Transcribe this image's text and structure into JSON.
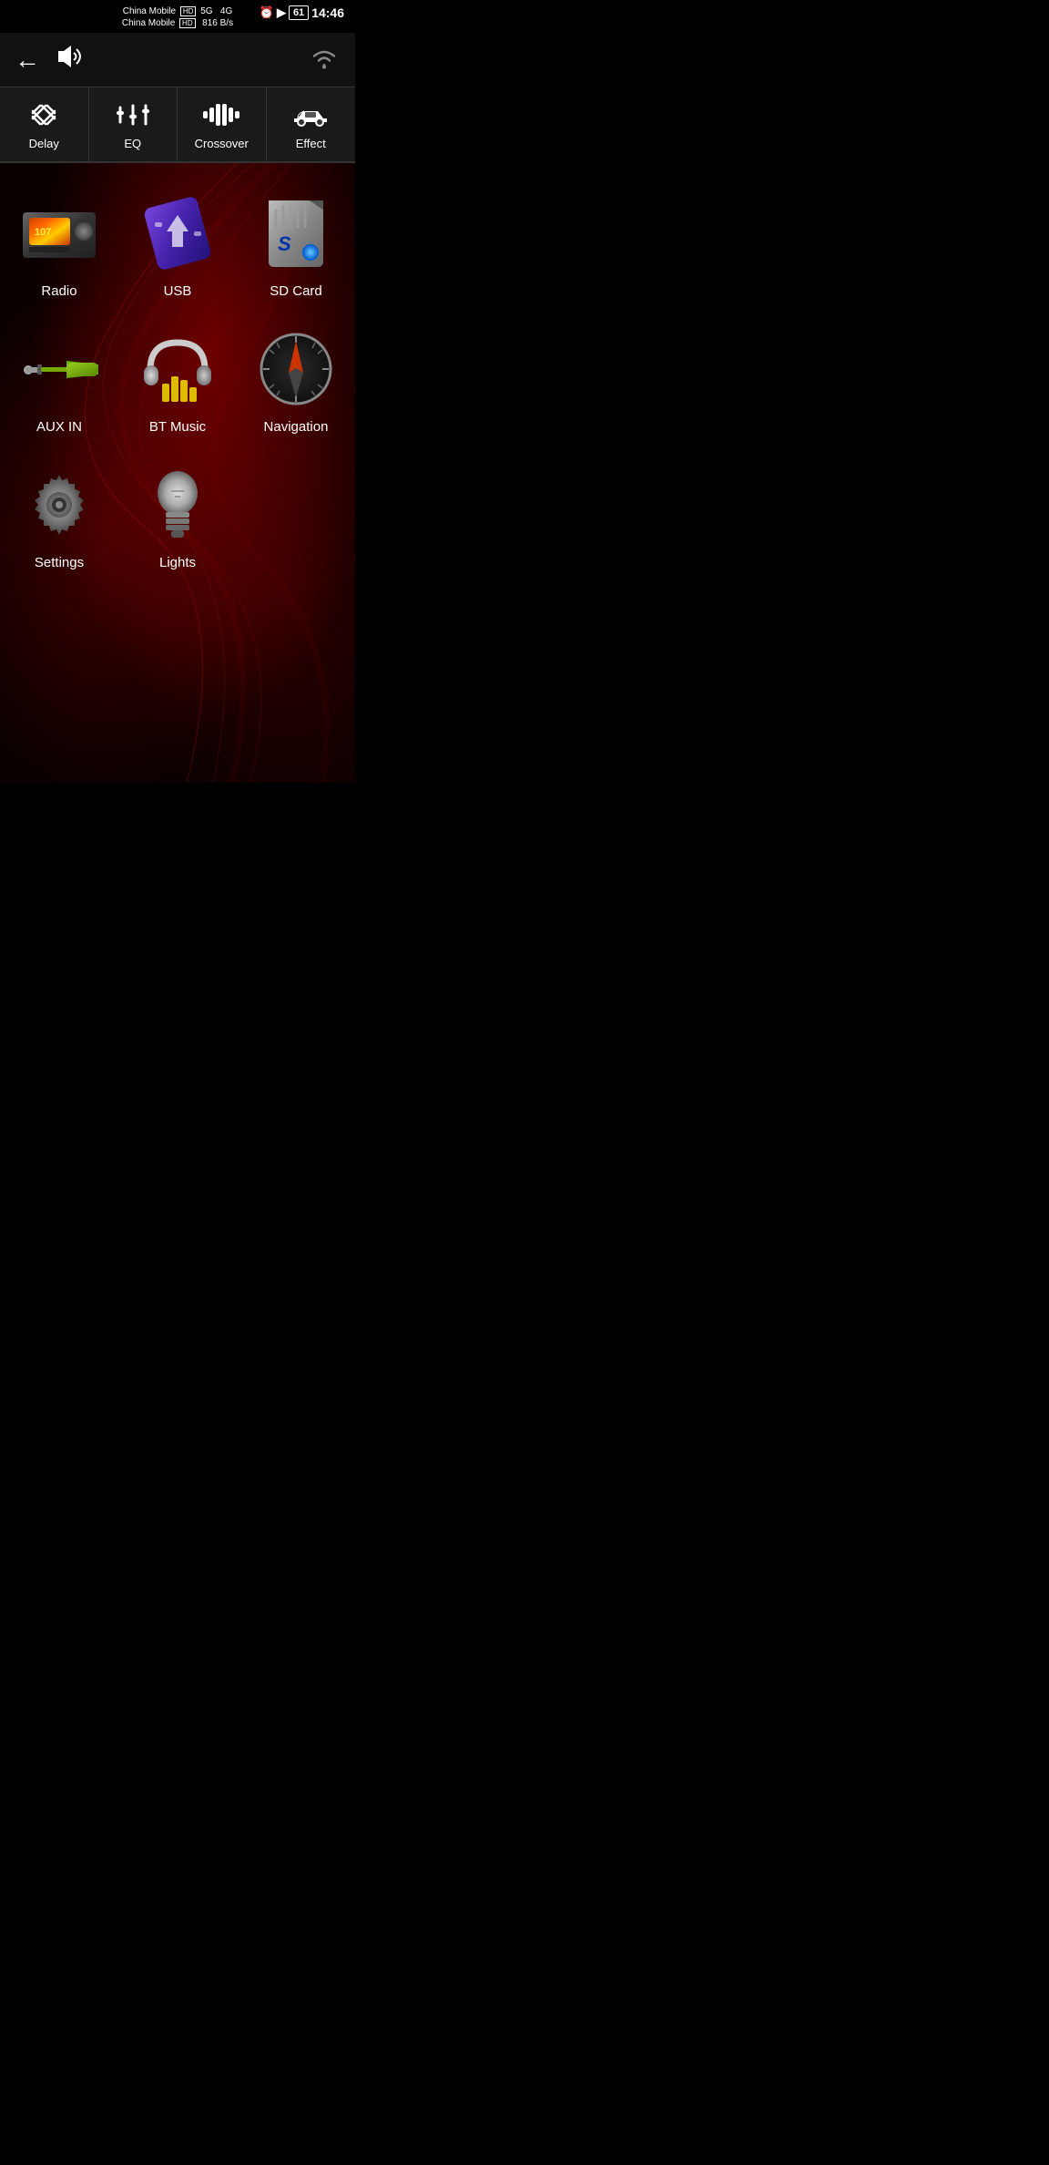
{
  "statusBar": {
    "carrier1": "China Mobile",
    "carrier2": "China Mobile",
    "hd1": "HD",
    "hd2": "HD",
    "network": "5G",
    "network2": "4G",
    "speed": "816 B/s",
    "time": "14:46",
    "battery": "61"
  },
  "header": {
    "backLabel": "←",
    "audioLabel": "🔊"
  },
  "tabs": [
    {
      "id": "delay",
      "label": "Delay",
      "icon": "delay-icon"
    },
    {
      "id": "eq",
      "label": "EQ",
      "icon": "eq-icon"
    },
    {
      "id": "crossover",
      "label": "Crossover",
      "icon": "crossover-icon"
    },
    {
      "id": "effect",
      "label": "Effect",
      "icon": "effect-icon"
    }
  ],
  "apps": [
    {
      "id": "radio",
      "label": "Radio",
      "icon": "radio-icon"
    },
    {
      "id": "usb",
      "label": "USB",
      "icon": "usb-icon"
    },
    {
      "id": "sdcard",
      "label": "SD Card",
      "icon": "sdcard-icon"
    },
    {
      "id": "auxin",
      "label": "AUX IN",
      "icon": "aux-icon"
    },
    {
      "id": "btmusic",
      "label": "BT Music",
      "icon": "btmusic-icon"
    },
    {
      "id": "navigation",
      "label": "Navigation",
      "icon": "nav-icon"
    },
    {
      "id": "settings",
      "label": "Settings",
      "icon": "settings-icon"
    },
    {
      "id": "lights",
      "label": "Lights",
      "icon": "lights-icon"
    }
  ],
  "colors": {
    "background": "#000000",
    "accentRed": "#cc0000",
    "tabBg": "#1a1a1a",
    "headerBg": "#111111"
  }
}
